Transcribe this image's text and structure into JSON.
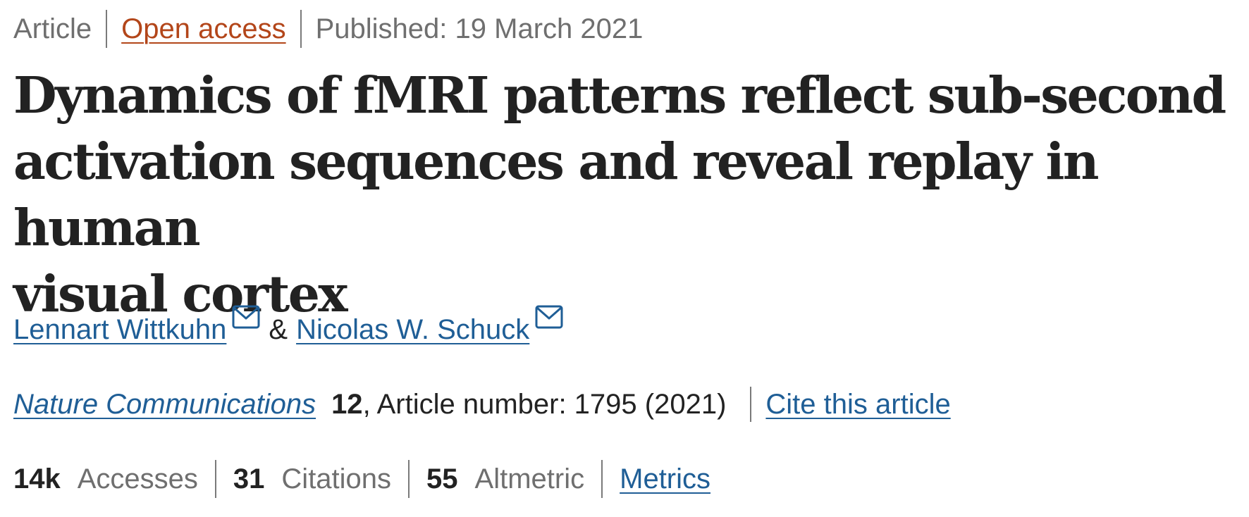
{
  "header": {
    "article_type": "Article",
    "access": "Open access",
    "published": "Published: 19 March 2021"
  },
  "title": {
    "line1": "Dynamics of fMRI patterns reflect sub-second",
    "line2": "activation sequences and reveal replay in human",
    "line3": "visual cortex"
  },
  "authors": {
    "author1": "Lennart Wittkuhn",
    "connector": "&",
    "author2": "Nicolas W. Schuck",
    "mail_icon": "envelope-icon"
  },
  "citation": {
    "journal": "Nature Communications",
    "volume": "12",
    "rest": ", Article number: 1795 (2021)",
    "cite_link": "Cite this article"
  },
  "metrics": {
    "accesses_value": "14k",
    "accesses_label": "Accesses",
    "citations_value": "31",
    "citations_label": "Citations",
    "altmetric_value": "55",
    "altmetric_label": "Altmetric",
    "metrics_link": "Metrics"
  },
  "colors": {
    "link": "#1f5e96",
    "open_access": "#b3461a",
    "muted_text": "#6f6f6f",
    "title_text": "#222222"
  }
}
